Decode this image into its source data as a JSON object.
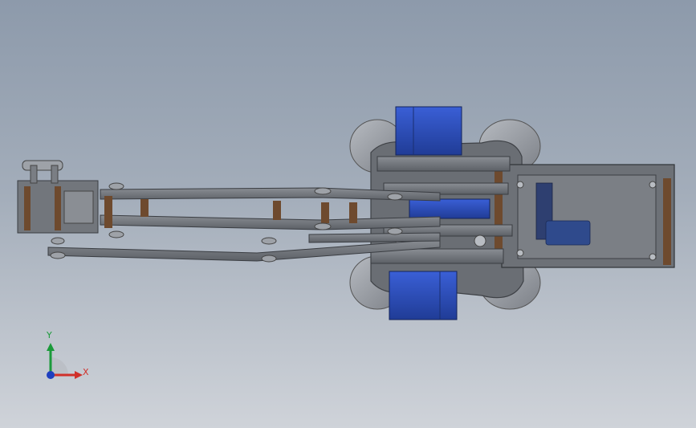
{
  "viewport": {
    "model": "robot-arm-assembly",
    "background": [
      "#8d9aab",
      "#cfd3d9"
    ]
  },
  "colors": {
    "metal": "#6f7379",
    "metal_light": "#8e9298",
    "metal_dark": "#45484d",
    "motor_blue": "#2f4fbf",
    "motor_blue_dark": "#1d337e",
    "wood": "#6e4a2e",
    "wheel": "#9a9ea4",
    "board": "#2f4a8c"
  },
  "triad": {
    "x_label": "X",
    "y_label": "Y",
    "x_color": "#d0302a",
    "y_color": "#1a9a3a",
    "z_color": "#1f3fbf",
    "icons": [
      "triad-icon"
    ]
  }
}
